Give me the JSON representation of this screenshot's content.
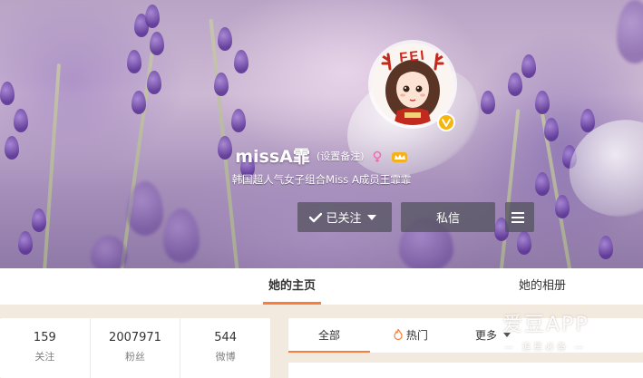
{
  "profile": {
    "name": "missA霏",
    "remark_link": "(设置备注)",
    "bio": "韩国超人气女子组合Miss A成员王霏霏",
    "avatar_sign": "FEI"
  },
  "actions": {
    "follow_label": "已关注",
    "message_label": "私信"
  },
  "tabs": [
    {
      "label": "她的主页",
      "active": true
    },
    {
      "label": "她的相册",
      "active": false
    }
  ],
  "stats": [
    {
      "value": "159",
      "label": "关注"
    },
    {
      "value": "2007971",
      "label": "粉丝"
    },
    {
      "value": "544",
      "label": "微博"
    }
  ],
  "feed_filter": {
    "all_label": "全部",
    "hot_label": "热门",
    "more_label": "更多"
  },
  "watermark": {
    "title": "爱豆APP",
    "subtitle": "追星必备"
  },
  "colors": {
    "accent": "#fa7d3c",
    "verify": "#f6b40e",
    "button_bg": "rgba(80,80,90,0.72)"
  }
}
